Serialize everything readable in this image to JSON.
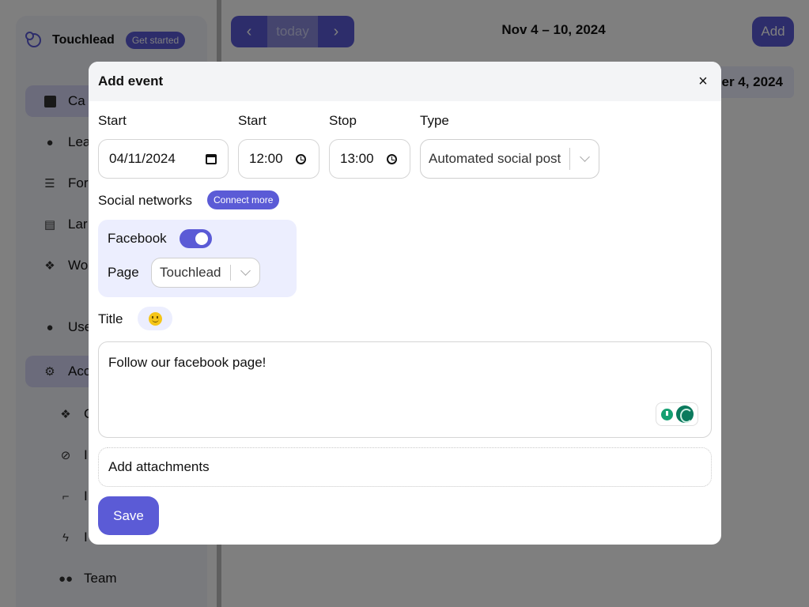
{
  "app": {
    "brand": "Touchlead",
    "badge": "Get started"
  },
  "sidebar": {
    "items": [
      {
        "label": "Ca",
        "icon": "calendar-icon"
      },
      {
        "label": "Lea",
        "icon": "user-icon"
      },
      {
        "label": "For",
        "icon": "list-icon"
      },
      {
        "label": "Lar",
        "icon": "newspaper-icon"
      },
      {
        "label": "Wo",
        "icon": "cubes-icon"
      },
      {
        "label": "User",
        "icon": "user-icon"
      },
      {
        "label": "Acco",
        "icon": "gear-icon"
      },
      {
        "label": "C",
        "icon": "cubes-icon"
      },
      {
        "label": "I",
        "icon": "ban-icon"
      },
      {
        "label": "I",
        "icon": "stairs-icon"
      },
      {
        "label": "I",
        "icon": "bolt-icon"
      },
      {
        "label": "Team",
        "icon": "users-icon"
      }
    ]
  },
  "toolbar": {
    "prev": "‹",
    "today": "today",
    "next": "›",
    "range": "Nov 4 – 10, 2024",
    "add": "Add",
    "day_header": "er 4, 2024"
  },
  "modal": {
    "title": "Add event",
    "close": "×",
    "start_date_label": "Start",
    "start_date_value": "04/11/2024",
    "start_time_label": "Start",
    "start_time_value": "12:00",
    "stop_label": "Stop",
    "stop_value": "13:00",
    "type_label": "Type",
    "type_value": "Automated social post",
    "social_label": "Social networks",
    "connect_more": "Connect more",
    "facebook_label": "Facebook",
    "facebook_enabled": true,
    "page_label": "Page",
    "page_value": "Touchlead",
    "title_label": "Title",
    "message": "Follow our facebook page!",
    "attachments": "Add attachments",
    "save": "Save"
  },
  "colors": {
    "accent": "#5b5bd6",
    "accent_light": "#eceefe"
  }
}
